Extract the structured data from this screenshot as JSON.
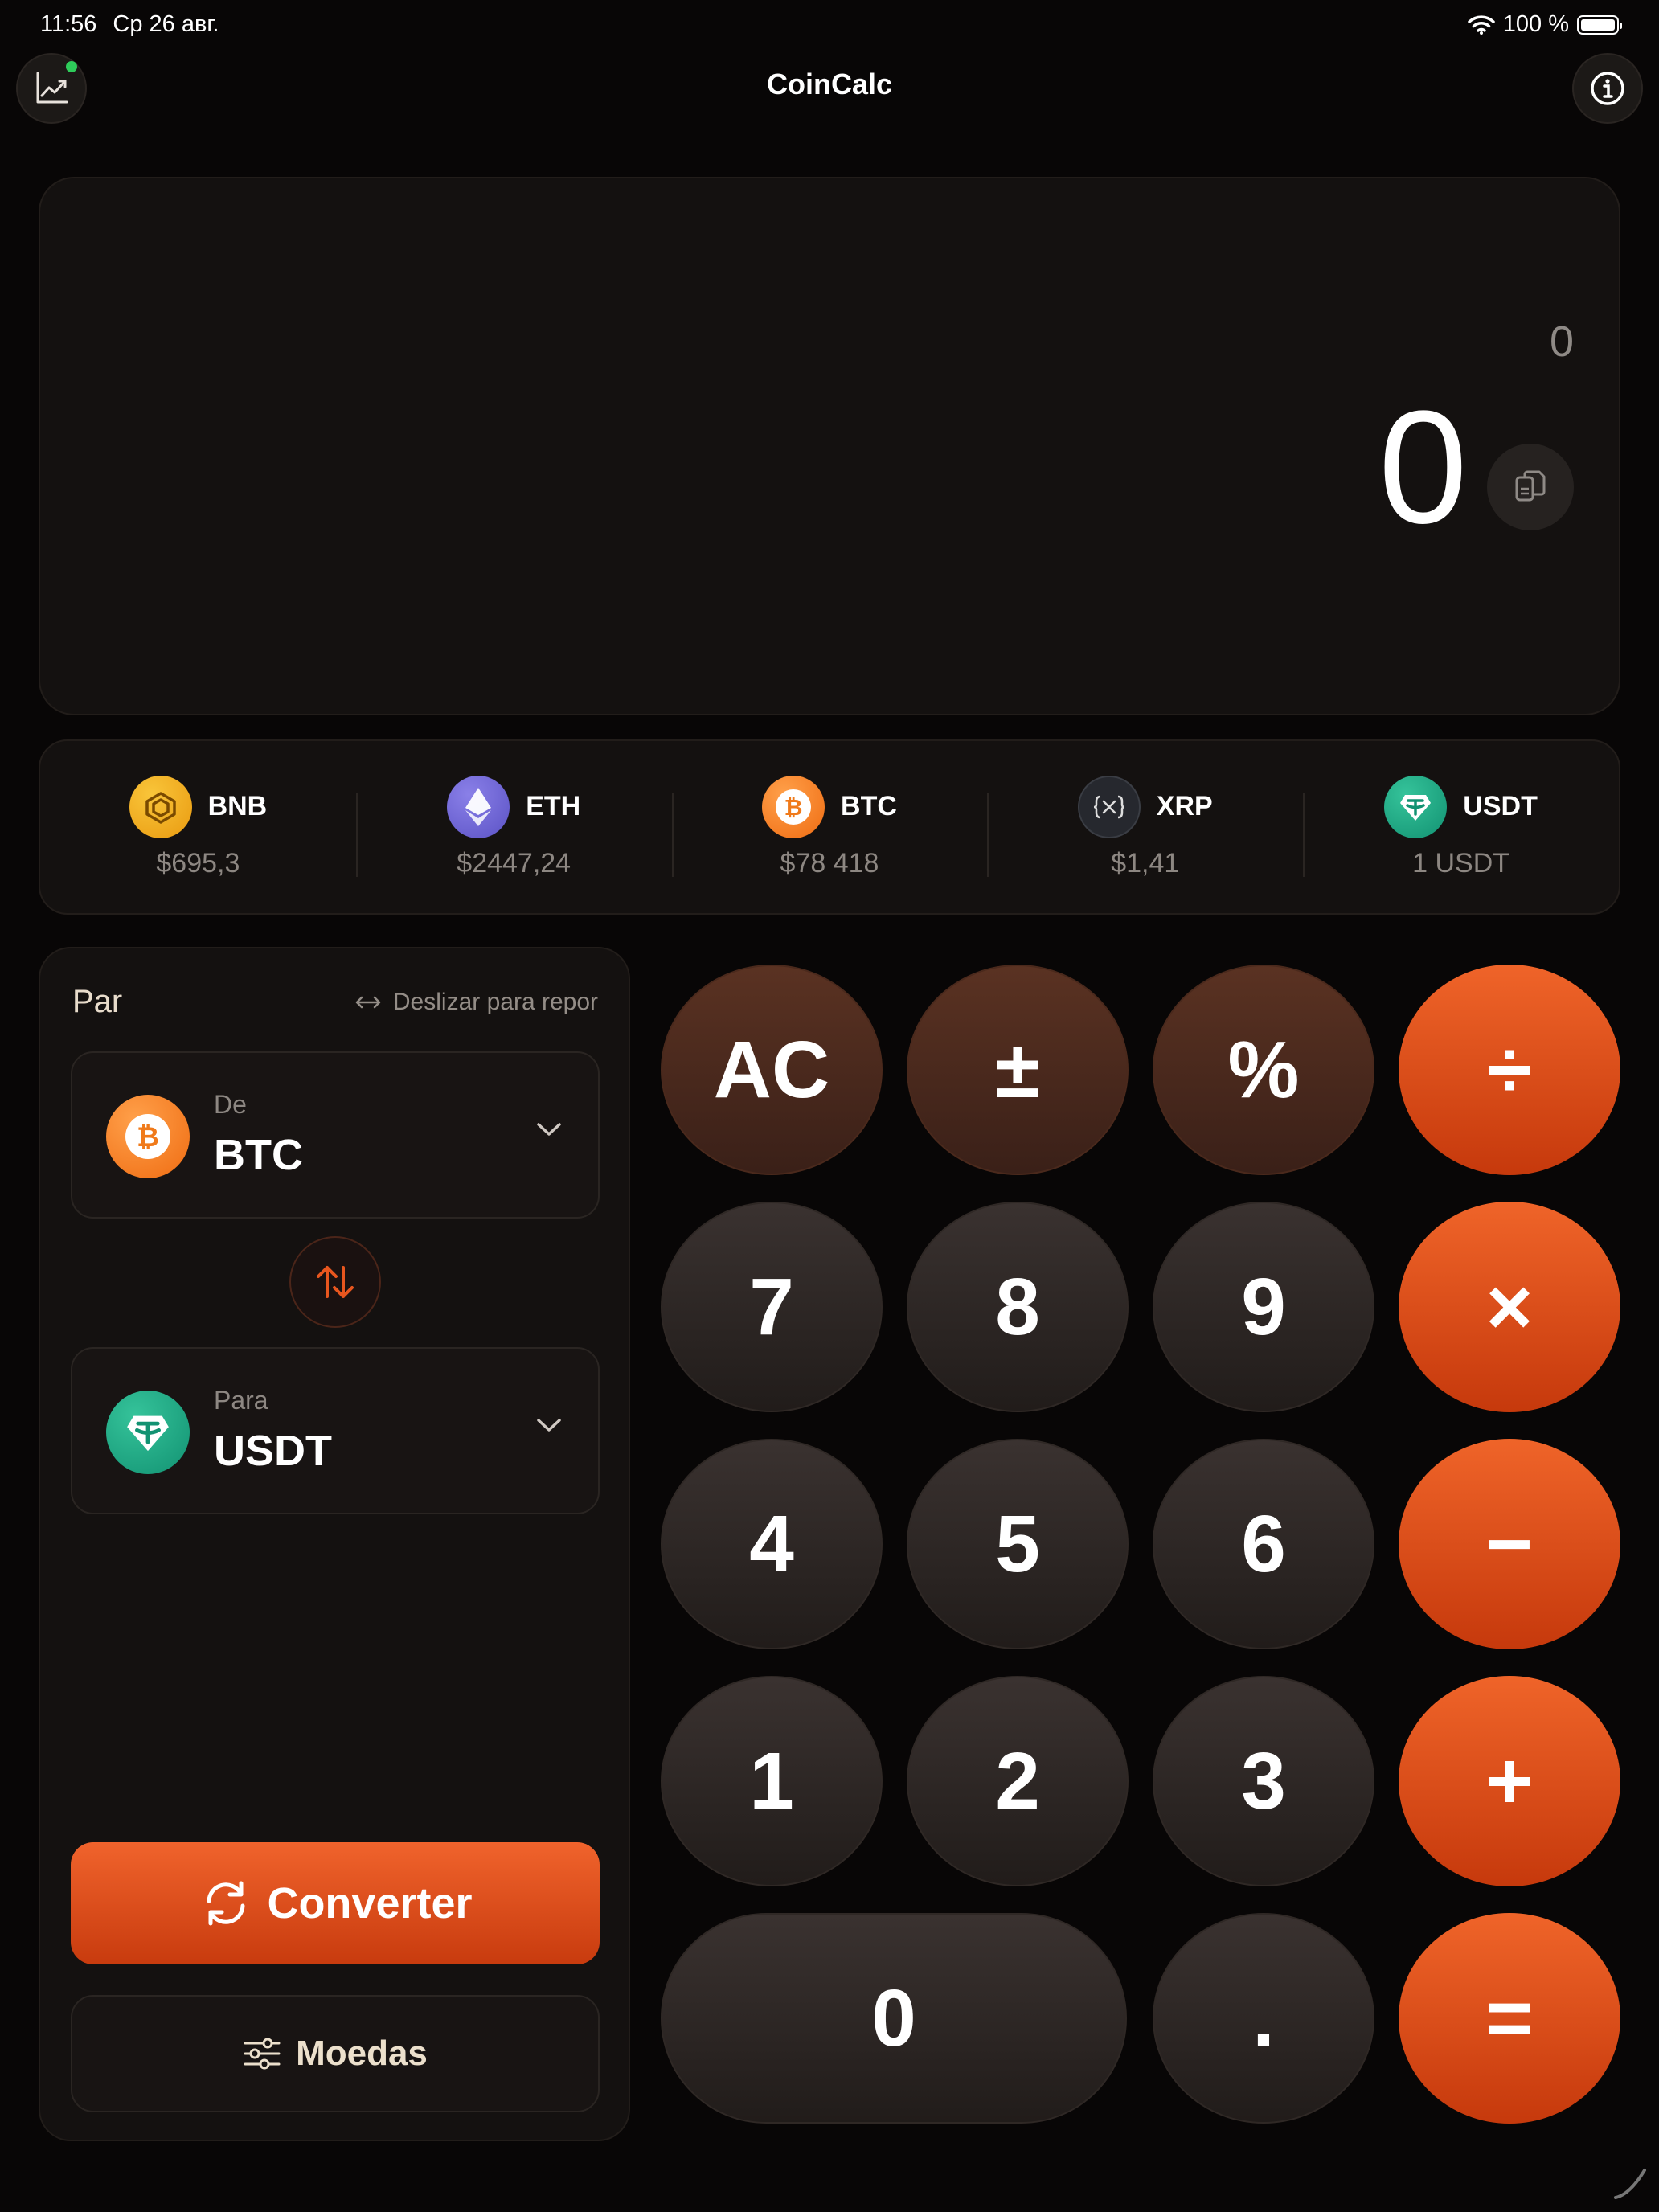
{
  "status_bar": {
    "time": "11:56",
    "date": "Ср 26 авг.",
    "battery": "100 %"
  },
  "header": {
    "title": "CoinCalc",
    "left_icon": "chart-icon",
    "right_icon": "info-icon"
  },
  "display": {
    "expression": "0",
    "result": "0"
  },
  "ticker": [
    {
      "symbol": "BNB",
      "price": "$695,3",
      "color": "#f0b90b"
    },
    {
      "symbol": "ETH",
      "price": "$2447,24",
      "color": "#627eea"
    },
    {
      "symbol": "BTC",
      "price": "$78 418",
      "color": "#f7931a"
    },
    {
      "symbol": "XRP",
      "price": "$1,41",
      "color": "#23292f"
    },
    {
      "symbol": "USDT",
      "price": "1 USDT",
      "color": "#26a17b"
    }
  ],
  "pair": {
    "title": "Par",
    "swipe_hint": "Deslizar para repor",
    "from": {
      "caption": "De",
      "value": "BTC"
    },
    "to": {
      "caption": "Para",
      "value": "USDT"
    },
    "convert_label": "Converter",
    "currencies_label": "Moedas"
  },
  "keypad": {
    "ac": "AC",
    "sign": "±",
    "percent": "%",
    "divide": "÷",
    "seven": "7",
    "eight": "8",
    "nine": "9",
    "multiply": "×",
    "four": "4",
    "five": "5",
    "six": "6",
    "minus": "−",
    "one": "1",
    "two": "2",
    "three": "3",
    "plus": "+",
    "zero": "0",
    "dot": ".",
    "equals": "="
  },
  "colors": {
    "accent": "#e8561e",
    "background": "#080606",
    "panel": "#141110"
  }
}
